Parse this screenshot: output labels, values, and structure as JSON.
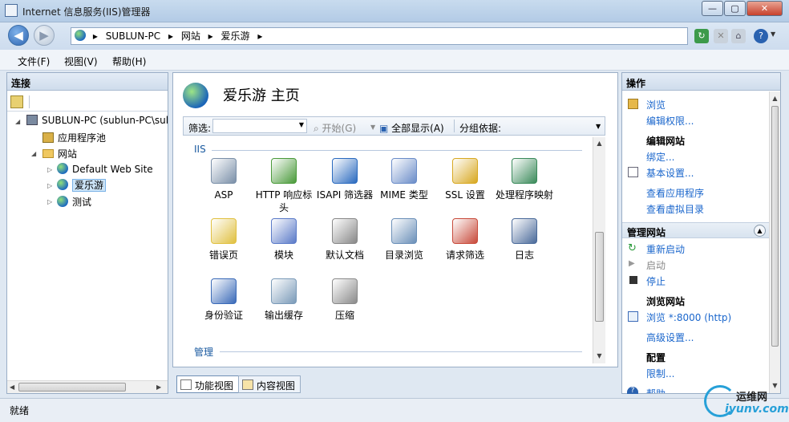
{
  "window": {
    "title": "Internet 信息服务(IIS)管理器",
    "buttons": {
      "minimize": "—",
      "maximize": "▢",
      "close": "✕"
    }
  },
  "address": {
    "crumbs": [
      "SUBLUN-PC",
      "网站",
      "爱乐游"
    ],
    "separator": "▸"
  },
  "menu": {
    "file": "文件(F)",
    "view": "视图(V)",
    "help": "帮助(H)"
  },
  "connections": {
    "header": "连接",
    "server": "SUBLUN-PC (sublun-PC\\sul",
    "app_pools": "应用程序池",
    "sites": "网站",
    "site_items": [
      "Default Web Site",
      "爱乐游",
      "测试"
    ]
  },
  "center": {
    "title": "爱乐游 主页",
    "filter": {
      "label": "筛选:",
      "go": "开始(G)",
      "show_all": "全部显示(A)",
      "group_by": "分组依据:"
    },
    "groups": [
      {
        "name": "IIS",
        "features": [
          {
            "label": "ASP",
            "icon": "asp-icon",
            "color": "#7a8fa8"
          },
          {
            "label": "HTTP 响应标头",
            "icon": "http-headers-icon",
            "color": "#4a9a3a"
          },
          {
            "label": "ISAPI 筛选器",
            "icon": "isapi-filter-icon",
            "color": "#2a6abf"
          },
          {
            "label": "MIME 类型",
            "icon": "mime-icon",
            "color": "#6a8cc8"
          },
          {
            "label": "SSL 设置",
            "icon": "lock-icon",
            "color": "#d8a820"
          },
          {
            "label": "处理程序映射",
            "icon": "handler-mapping-icon",
            "color": "#3a8a5a"
          },
          {
            "label": "错误页",
            "icon": "error-page-icon",
            "color": "#e0c040"
          },
          {
            "label": "模块",
            "icon": "modules-icon",
            "color": "#5a7ac8"
          },
          {
            "label": "默认文档",
            "icon": "default-doc-icon",
            "color": "#888888"
          },
          {
            "label": "目录浏览",
            "icon": "dir-browse-icon",
            "color": "#6a8fb8"
          },
          {
            "label": "请求筛选",
            "icon": "request-filter-icon",
            "color": "#c84a3a"
          },
          {
            "label": "日志",
            "icon": "log-icon",
            "color": "#4a6a9a"
          },
          {
            "label": "身份验证",
            "icon": "auth-icon",
            "color": "#3a6ab8"
          },
          {
            "label": "输出缓存",
            "icon": "output-cache-icon",
            "color": "#7a9ab8"
          },
          {
            "label": "压缩",
            "icon": "compression-icon",
            "color": "#8a8a8a"
          }
        ]
      },
      {
        "name": "管理",
        "features": []
      }
    ]
  },
  "view_tabs": {
    "features": "功能视图",
    "content": "内容视图"
  },
  "actions": {
    "header": "操作",
    "browse": "浏览",
    "edit_perms": "编辑权限...",
    "edit_site": "编辑网站",
    "bindings": "绑定...",
    "basic_settings": "基本设置...",
    "view_apps": "查看应用程序",
    "view_vdirs": "查看虚拟目录",
    "manage_site": "管理网站",
    "restart": "重新启动",
    "start": "启动",
    "stop": "停止",
    "browse_site": "浏览网站",
    "browse_port": "浏览 *:8000 (http)",
    "advanced": "高级设置...",
    "config": "配置",
    "limits": "限制...",
    "help": "帮助"
  },
  "status": "就绪",
  "watermark": {
    "line1": "运维网",
    "line2": "iyunv.com"
  }
}
